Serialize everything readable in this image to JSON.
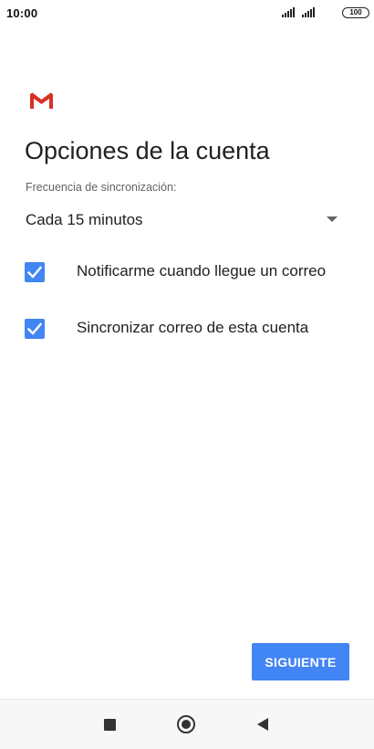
{
  "status_bar": {
    "time": "10:00",
    "battery": "100"
  },
  "header": {
    "logo": "gmail-logo",
    "title": "Opciones de la cuenta"
  },
  "sync": {
    "label": "Frecuencia de sincronización:",
    "selected_value": "Cada 15 minutos"
  },
  "options": [
    {
      "label": "Notificarme cuando llegue un correo",
      "checked": true
    },
    {
      "label": "Sincronizar correo de esta cuenta",
      "checked": true
    }
  ],
  "actions": {
    "next_label": "SIGUIENTE"
  },
  "colors": {
    "accent": "#4285f4",
    "gmail_red": "#d93025"
  }
}
